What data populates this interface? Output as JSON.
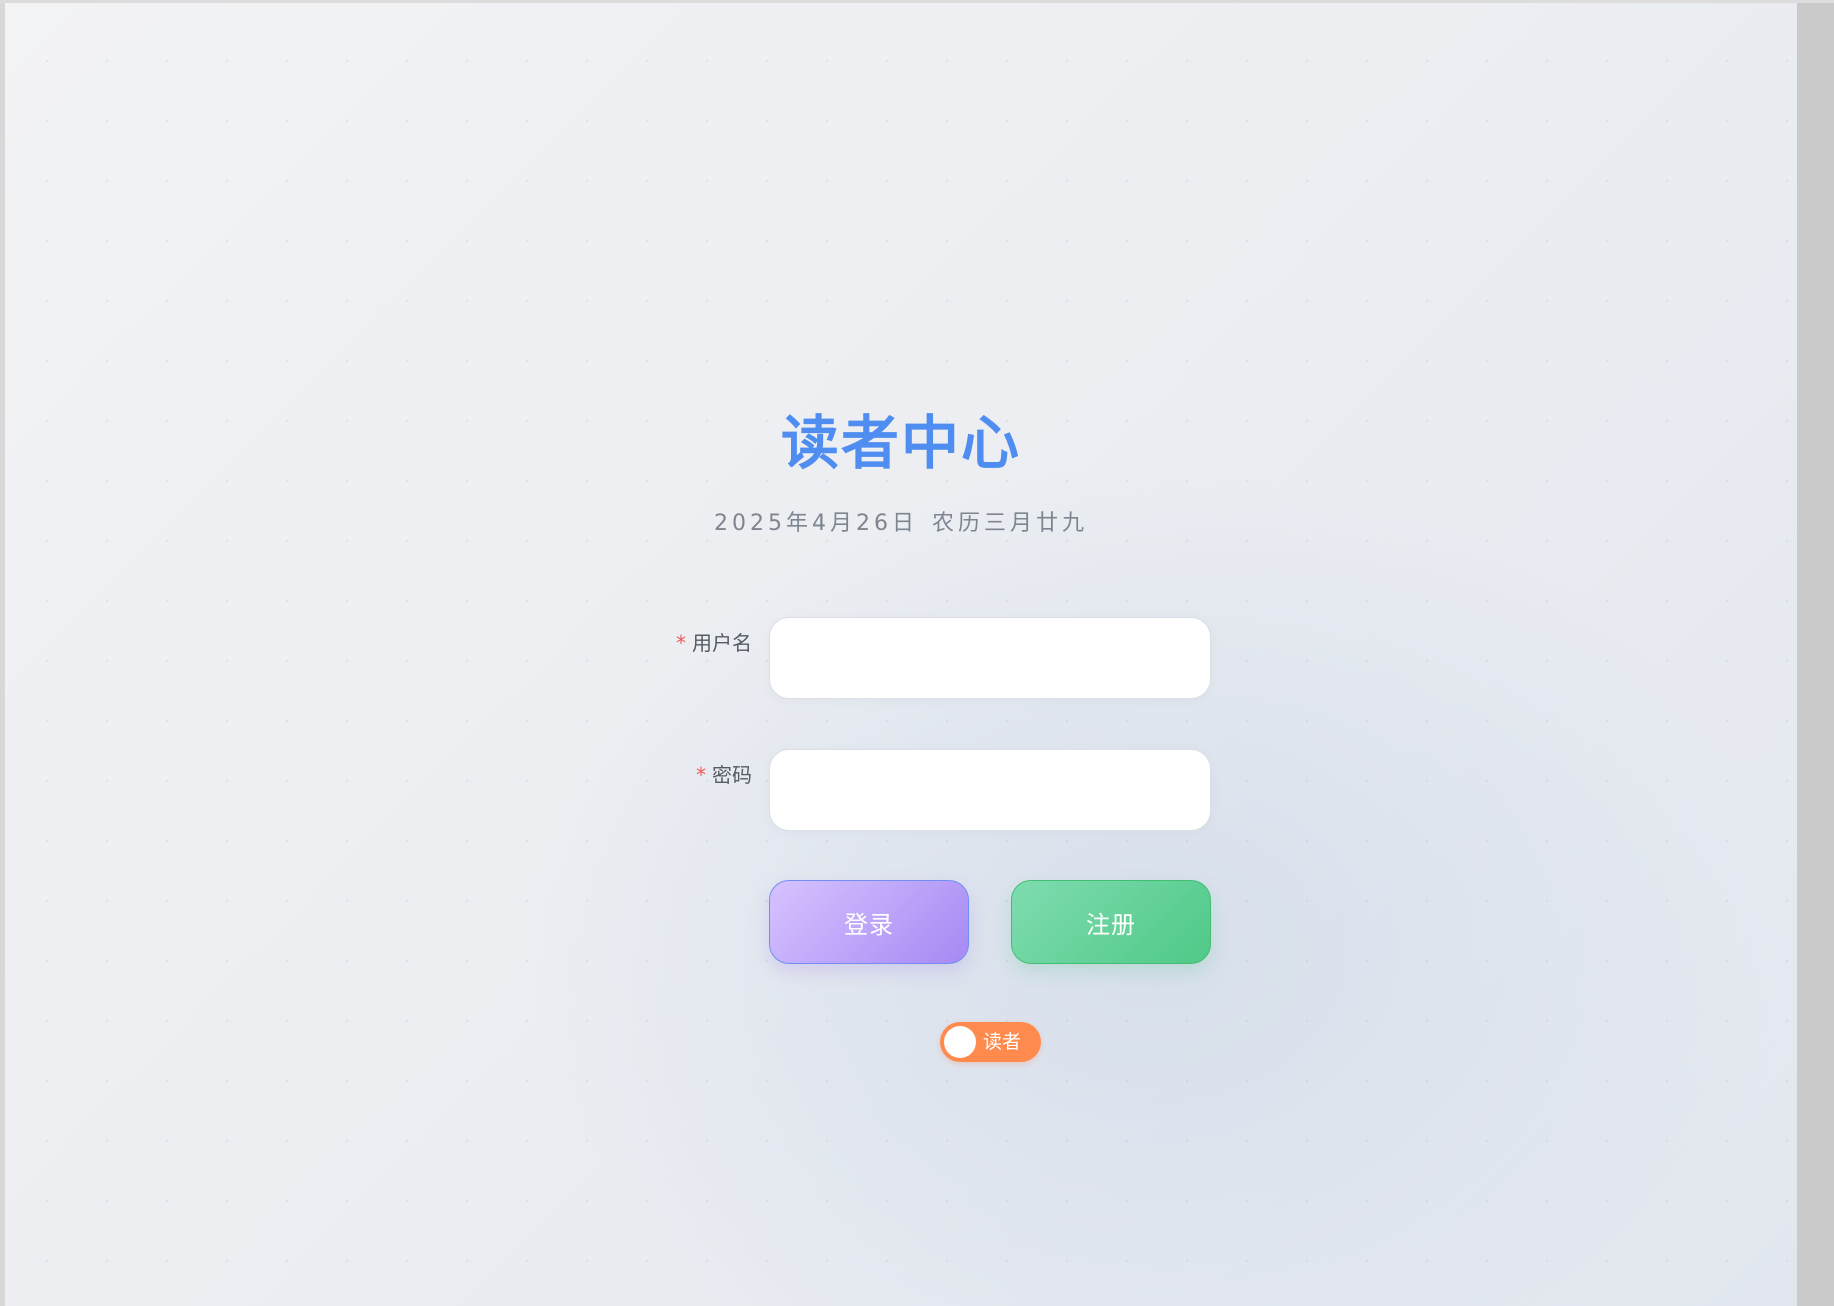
{
  "login_form": {
    "title": "读者中心",
    "date": "2025年4月26日",
    "lunar_date": "农历三月廿九",
    "username_label": "用户名",
    "username_value": "",
    "password_label": "密码",
    "password_value": "",
    "required_marker": "*",
    "login_button": "登录",
    "register_button": "注册",
    "role_toggle_label": "读者"
  },
  "colors": {
    "title": "#4f8ef0",
    "required": "#f05a5a",
    "login_gradient": [
      "#d6c3ff",
      "#a689f3"
    ],
    "register_gradient": [
      "#7fdcb0",
      "#4fc987"
    ],
    "role_toggle": "#ff8a4d"
  }
}
